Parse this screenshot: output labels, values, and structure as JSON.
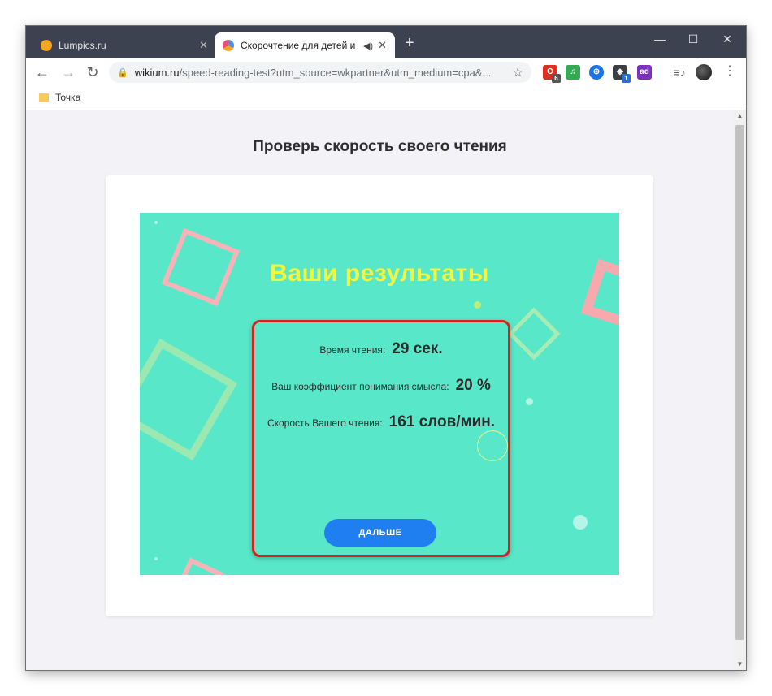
{
  "browser": {
    "tabs": [
      {
        "title": "Lumpics.ru",
        "favicon_color": "#f5a623"
      },
      {
        "title": "Скорочтение для детей и в",
        "favicon_color": "#4a90e2"
      }
    ],
    "window_controls": {
      "minimize": "—",
      "maximize": "☐",
      "close": "✕"
    },
    "new_tab": "+",
    "url_host": "wikium.ru",
    "url_path": "/speed-reading-test?utm_source=wkpartner&utm_medium=cpa&...",
    "extensions": [
      {
        "name": "opera-icon",
        "color": "#d93025",
        "badge": "6"
      },
      {
        "name": "music-icon",
        "color": "#34a853",
        "badge": ""
      },
      {
        "name": "globe-icon",
        "color": "#1a73e8",
        "badge": ""
      },
      {
        "name": "cube-icon",
        "color": "#3c4043",
        "badge": "1"
      },
      {
        "name": "adblock-icon",
        "color": "#7b2fbe",
        "badge": ""
      }
    ],
    "bookmark": "Точка"
  },
  "page": {
    "heading": "Проверь скорость своего чтения",
    "results": {
      "title": "Ваши результаты",
      "reading_time_label": "Время чтения:",
      "reading_time_value": "29 сек.",
      "comprehension_label": "Ваш коэффициент понимания смысла:",
      "comprehension_value": "20 %",
      "speed_label": "Скорость Вашего чтения:",
      "speed_value": "161 слов/мин.",
      "next_button": "ДАЛЬШЕ"
    }
  },
  "colors": {
    "game_bg": "#58e8c9",
    "title_yellow": "#f4f53d",
    "highlight_red": "#d91f1f",
    "button_blue": "#1f7ef0"
  }
}
